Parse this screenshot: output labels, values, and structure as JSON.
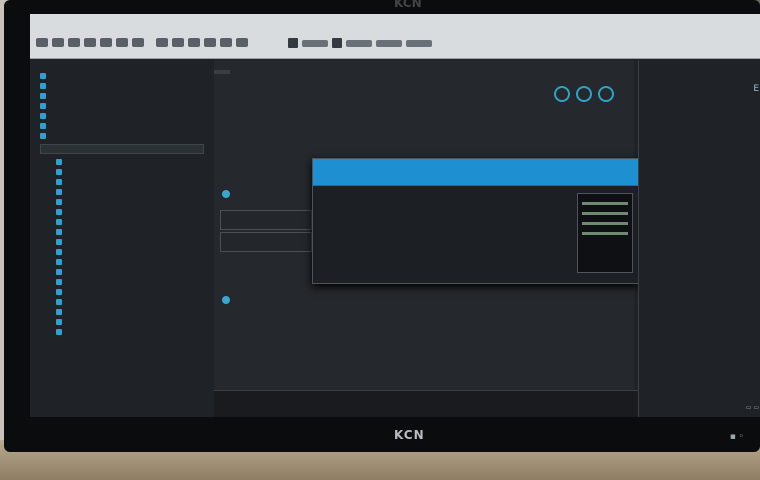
{
  "monitor": {
    "brand_top": "KCN",
    "brand_bottom": "KCN"
  },
  "toolbar": {
    "title": ""
  },
  "left_panel": {
    "header": "",
    "items": [
      "",
      "",
      "",
      "",
      "",
      "",
      "",
      "",
      "",
      "",
      "",
      "",
      "",
      "",
      "",
      "",
      "",
      "",
      "",
      "",
      "",
      "",
      "",
      "",
      ""
    ],
    "footer": [
      "",
      ""
    ]
  },
  "center": {
    "tab": "",
    "title": "",
    "section_head": "",
    "lines": [
      "",
      "",
      "",
      "",
      ""
    ],
    "cards": [
      "",
      "",
      ""
    ]
  },
  "popup": {
    "columns": [
      "",
      "",
      "",
      "",
      ""
    ],
    "lines": [
      "",
      "",
      "",
      ""
    ],
    "thumb_text": ""
  },
  "right_panel": {
    "title": "",
    "lines": [
      "",
      ""
    ],
    "footer": "E"
  },
  "colors": {
    "accent": "#1e90d2",
    "screen_bg": "#202327"
  }
}
